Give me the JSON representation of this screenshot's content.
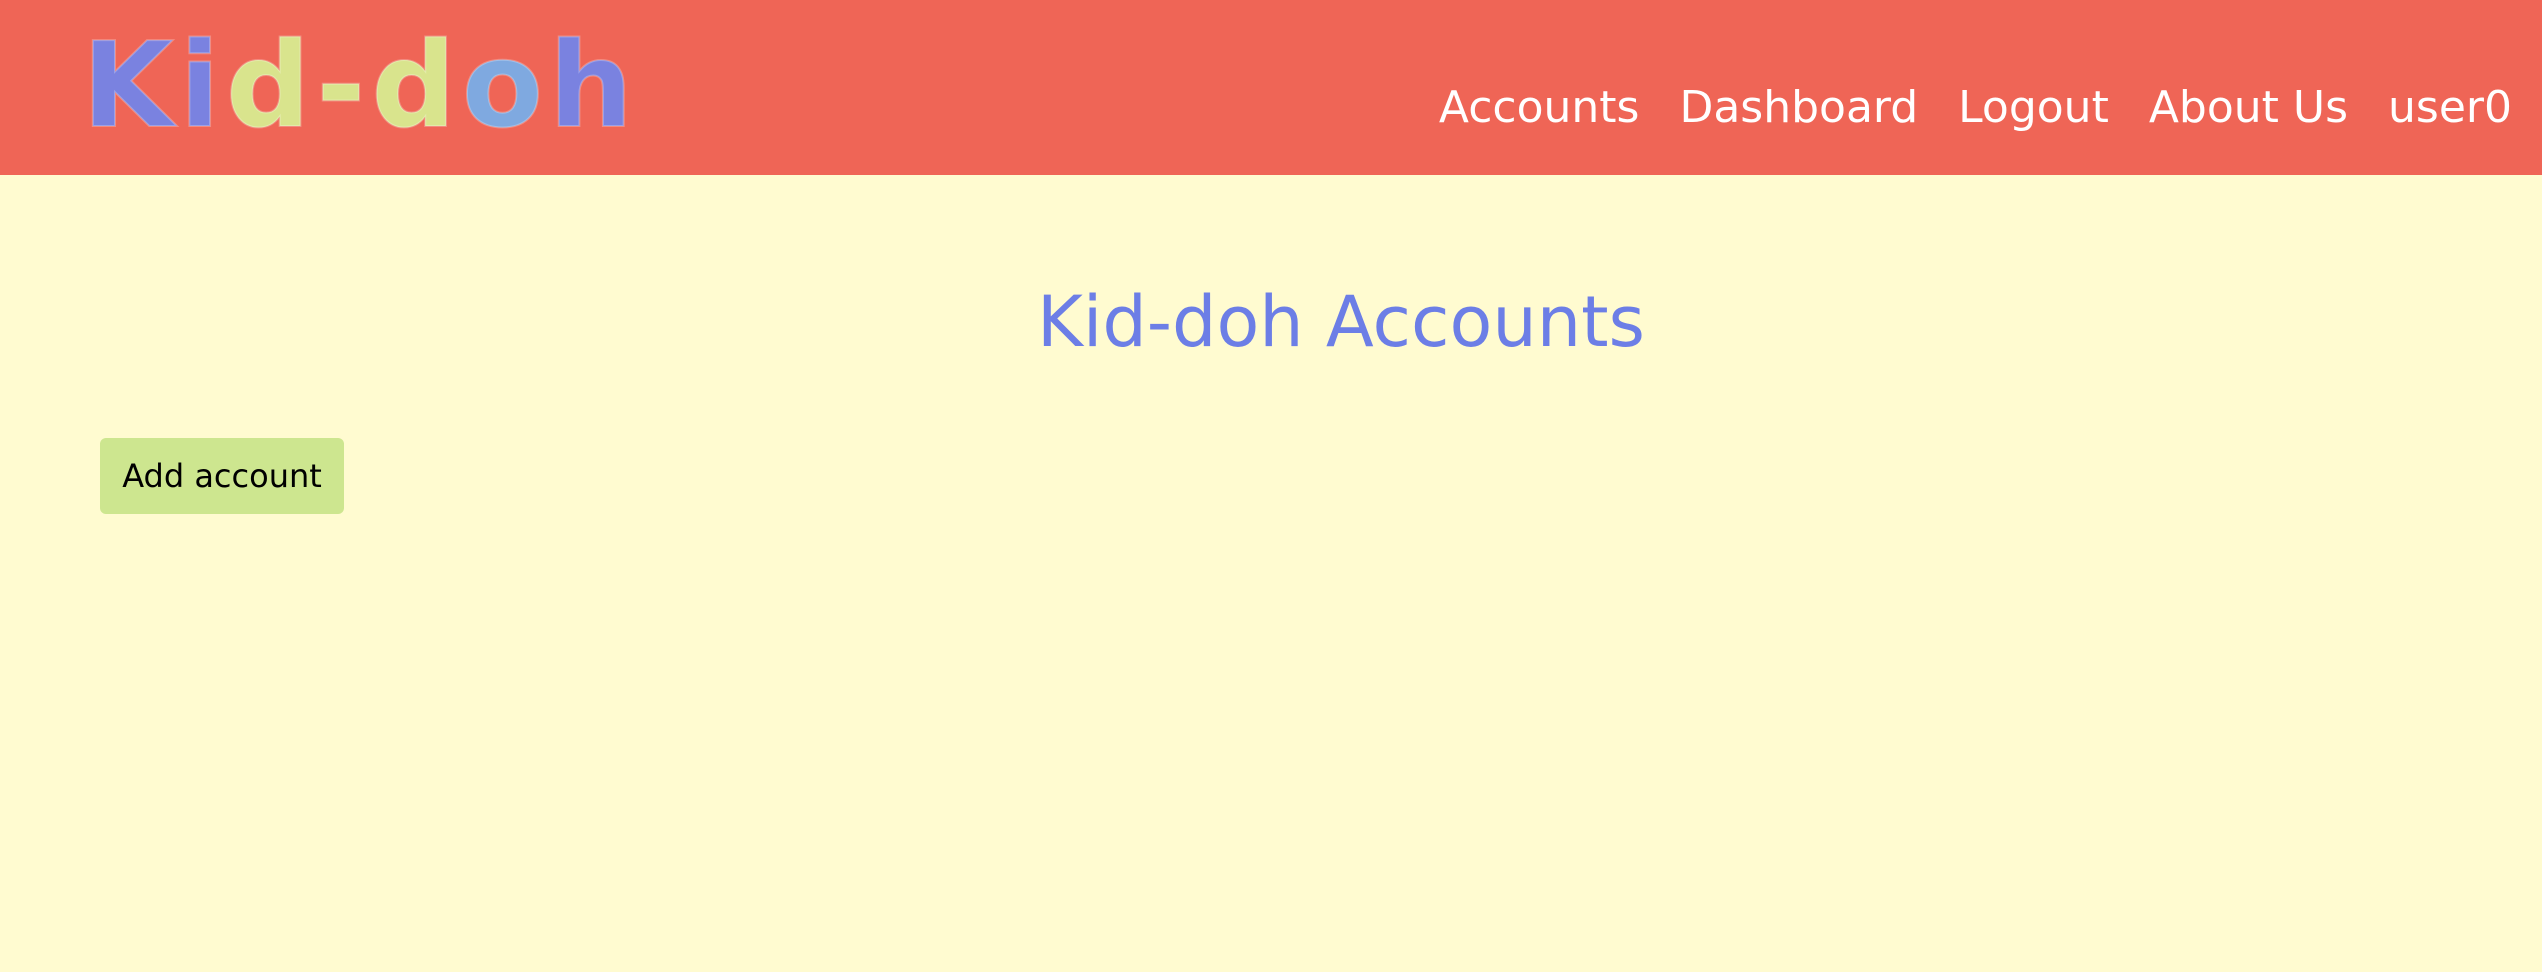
{
  "colors": {
    "header_bg": "#ef6556",
    "page_bg": "#fffbd0",
    "title_color": "#6c7ee6",
    "button_bg": "#cde68f",
    "nav_text": "#ffffff"
  },
  "logo": {
    "letters": [
      {
        "char": "K",
        "color": "#7a82e0"
      },
      {
        "char": "i",
        "color": "#7a82e0"
      },
      {
        "char": "d",
        "color": "#d9e48d"
      },
      {
        "char": "-",
        "color": "#d9e48d"
      },
      {
        "char": "d",
        "color": "#d9e48d"
      },
      {
        "char": "o",
        "color": "#7fa9e0"
      },
      {
        "char": "h",
        "color": "#7a82e0"
      }
    ]
  },
  "nav": {
    "items": [
      "Accounts",
      "Dashboard",
      "Logout",
      "About Us",
      "user0"
    ]
  },
  "main": {
    "title": "Kid-doh Accounts",
    "add_button_label": "Add account"
  }
}
